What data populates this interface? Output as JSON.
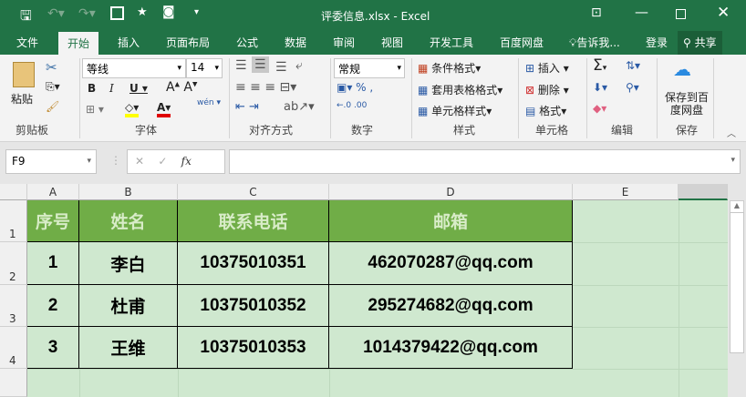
{
  "title": "评委信息.xlsx - Excel",
  "menu_tabs": [
    "文件",
    "开始",
    "插入",
    "页面布局",
    "公式",
    "数据",
    "审阅",
    "视图",
    "开发工具",
    "百度网盘"
  ],
  "tell_me": "告诉我...",
  "login": "登录",
  "share": "共享",
  "ribbon": {
    "paste": "粘贴",
    "clipboard": "剪贴板",
    "font_name": "等线",
    "font_size": "14",
    "font": "字体",
    "wen": "wén",
    "alignment": "对齐方式",
    "number_format": "常规",
    "number": "数字",
    "cond_format": "条件格式",
    "table_format": "套用表格格式",
    "cell_style": "单元格样式",
    "styles": "样式",
    "insert": "插入",
    "delete": "删除",
    "format": "格式",
    "cells": "单元格",
    "editing": "编辑",
    "save_baidu": "保存到百度网盘",
    "save": "保存"
  },
  "name_box": "F9",
  "formula": "",
  "columns": [
    "A",
    "B",
    "C",
    "D",
    "E"
  ],
  "rows": [
    "1",
    "2",
    "3",
    "4"
  ],
  "headers": [
    "序号",
    "姓名",
    "联系电话",
    "邮箱"
  ],
  "data": [
    [
      "1",
      "李白",
      "10375010351",
      "462070287@qq.com"
    ],
    [
      "2",
      "杜甫",
      "10375010352",
      "295274682@qq.com"
    ],
    [
      "3",
      "王维",
      "10375010353",
      "1014379422@qq.com"
    ]
  ]
}
